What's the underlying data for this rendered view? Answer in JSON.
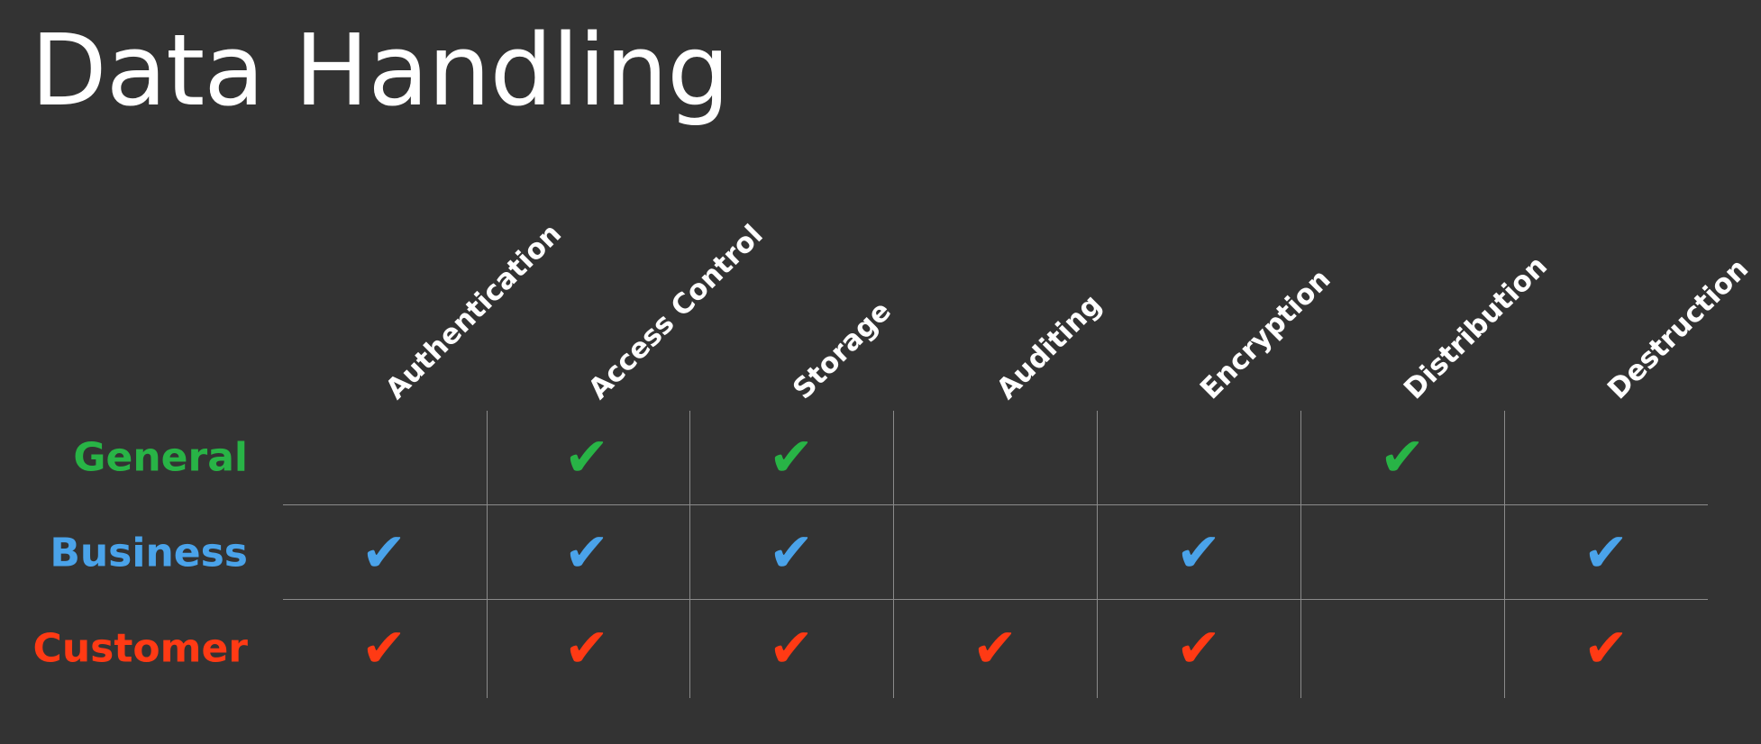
{
  "title": "Data Handling",
  "columns": [
    {
      "label": "Authentication"
    },
    {
      "label": "Access Control"
    },
    {
      "label": "Storage"
    },
    {
      "label": "Auditing"
    },
    {
      "label": "Encryption"
    },
    {
      "label": "Distribution"
    },
    {
      "label": "Destruction"
    }
  ],
  "rows": [
    {
      "label": "General",
      "color": "#28b446",
      "checks": [
        false,
        true,
        true,
        false,
        false,
        true,
        false
      ]
    },
    {
      "label": "Business",
      "color": "#4aa3ea",
      "checks": [
        true,
        true,
        true,
        false,
        true,
        false,
        true
      ]
    },
    {
      "label": "Customer",
      "color": "#ff3a14",
      "checks": [
        true,
        true,
        true,
        true,
        true,
        false,
        true
      ]
    }
  ],
  "check_glyph": "✔"
}
